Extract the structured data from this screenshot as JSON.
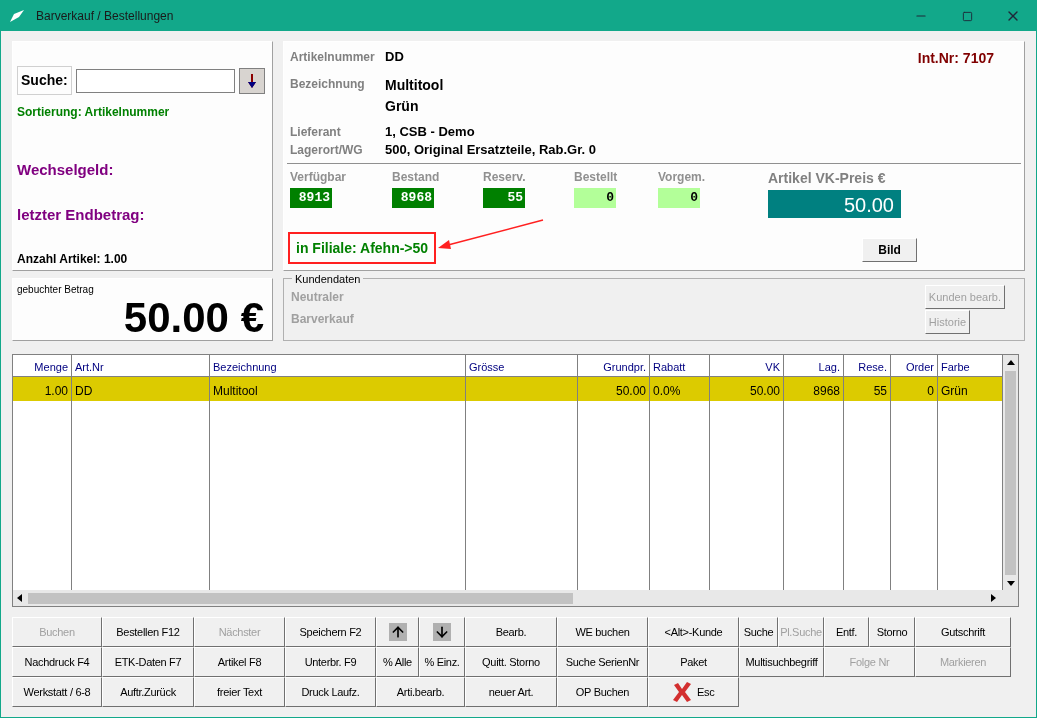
{
  "window": {
    "title": "Barverkauf / Bestellungen"
  },
  "search": {
    "label": "Suche:"
  },
  "sort_info": "Sortierung: Artikelnummer",
  "change_label": "Wechselgeld:",
  "last_total_label": "letzter Endbetrag:",
  "item_count": "Anzahl Artikel: 1.00",
  "booked": {
    "label": "gebuchter Betrag",
    "amount": "50.00 €"
  },
  "article": {
    "int_nr": "Int.Nr: 7107",
    "fields": [
      {
        "label": "Artikelnummer",
        "values": [
          "DD"
        ]
      },
      {
        "label": "Bezeichnung",
        "values": [
          "Multitool",
          "Grün"
        ]
      }
    ],
    "supplier_fields": [
      {
        "label": "Lieferant",
        "values": [
          "1, CSB - Demo"
        ]
      },
      {
        "label": "Lagerort/WG",
        "values": [
          "500, Original Ersatzteile, Rab.Gr. 0"
        ]
      }
    ],
    "stock": [
      {
        "label": "Verfügbar",
        "value": "8913",
        "color": "#008000"
      },
      {
        "label": "Bestand",
        "value": "8968",
        "color": "#008000"
      },
      {
        "label": "Reserv.",
        "value": "55",
        "color": "#008000"
      },
      {
        "label": "Bestellt",
        "value": "0",
        "color": "#b3ff99"
      },
      {
        "label": "Vorgem.",
        "value": "0",
        "color": "#b3ff99"
      }
    ],
    "price_label": "Artikel VK-Preis €",
    "price": "50.00",
    "branch_info": "in Filiale: Afehn->50",
    "image_button": "Bild"
  },
  "customer": {
    "title": "Kundendaten",
    "lines": [
      "Neutraler",
      "Barverkauf"
    ],
    "buttons": [
      {
        "label": "Kunden bearb.",
        "disabled": true
      },
      {
        "label": "Historie",
        "disabled": true
      }
    ]
  },
  "table": {
    "columns": [
      "Menge",
      "Art.Nr",
      "Bezeichnung",
      "Grösse",
      "Grundpr.",
      "Rabatt",
      "VK",
      "Lag.",
      "Rese.",
      "Order",
      "Farbe"
    ],
    "rows": [
      {
        "selected": true,
        "cells": [
          "1.00",
          "DD",
          "Multitool",
          "",
          "50.00",
          "0.0%",
          "50.00",
          "8968",
          "55",
          "0",
          "Grün"
        ]
      }
    ]
  },
  "buttons": [
    [
      {
        "kind": "text",
        "label": "Buchen",
        "disabled": true
      },
      {
        "kind": "text",
        "label": "Bestellen F12",
        "disabled": false
      },
      {
        "kind": "text",
        "label": "Nächster",
        "disabled": true
      },
      {
        "kind": "text",
        "label": "Speichern F2",
        "disabled": false
      },
      {
        "kind": "up",
        "disabled": false
      },
      {
        "kind": "down",
        "disabled": false
      },
      {
        "kind": "text",
        "label": "Bearb.",
        "disabled": false
      },
      {
        "kind": "text",
        "label": "WE buchen",
        "disabled": false
      },
      {
        "kind": "text",
        "label": "<Alt>-Kunde",
        "disabled": false
      },
      {
        "kind": "text",
        "label": "Suche",
        "disabled": false
      },
      {
        "kind": "text",
        "label": "Pl.Suche",
        "disabled": true
      },
      {
        "kind": "text",
        "label": "Entf.",
        "disabled": false
      },
      {
        "kind": "text",
        "label": "Storno",
        "disabled": false
      },
      {
        "kind": "text",
        "label": "Gutschrift",
        "disabled": false
      }
    ],
    [
      {
        "kind": "text",
        "label": "Nachdruck F4",
        "disabled": false
      },
      {
        "kind": "text",
        "label": "ETK-Daten F7",
        "disabled": false
      },
      {
        "kind": "text",
        "label": "Artikel F8",
        "disabled": false
      },
      {
        "kind": "text",
        "label": "Unterbr. F9",
        "disabled": false
      },
      {
        "kind": "text",
        "label": "% Alle",
        "disabled": false
      },
      {
        "kind": "text",
        "label": "% Einz.",
        "disabled": false
      },
      {
        "kind": "text",
        "label": "Quitt. Storno",
        "disabled": false
      },
      {
        "kind": "text",
        "label": "Suche SerienNr",
        "disabled": false
      },
      {
        "kind": "text",
        "label": "Paket",
        "disabled": false
      },
      {
        "kind": "text",
        "label": "Multisuchbegriff",
        "disabled": false
      },
      {
        "kind": "text",
        "label": "Folge Nr",
        "disabled": true
      },
      {
        "kind": "text",
        "label": "Markieren",
        "disabled": true
      }
    ],
    [
      {
        "kind": "text",
        "label": "Werkstatt / 6-8",
        "disabled": false
      },
      {
        "kind": "text",
        "label": "Auftr.Zurück",
        "disabled": false
      },
      {
        "kind": "text",
        "label": "freier Text",
        "disabled": false
      },
      {
        "kind": "text",
        "label": "Druck Laufz.",
        "disabled": false
      },
      {
        "kind": "text",
        "label": "Arti.bearb.",
        "disabled": false
      },
      {
        "kind": "text",
        "label": "neuer Art.",
        "disabled": false
      },
      {
        "kind": "text",
        "label": "OP Buchen",
        "disabled": false
      },
      {
        "kind": "esc",
        "label": "Esc",
        "disabled": false
      }
    ]
  ]
}
